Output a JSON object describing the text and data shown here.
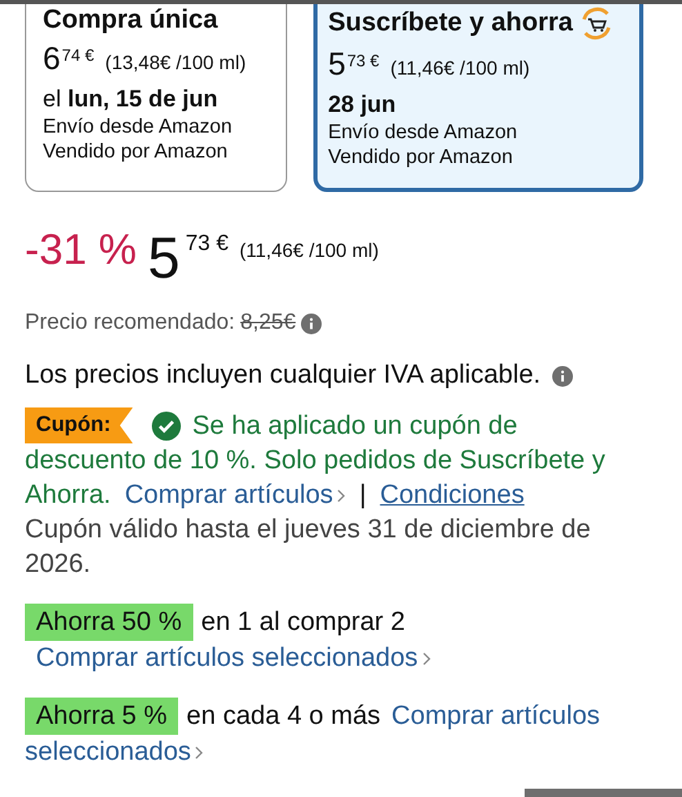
{
  "purchase_options": [
    {
      "title": "Compra única",
      "price_whole": "6",
      "price_fraction": "74 €",
      "unit_price": "(13,48€ /100 ml)",
      "delivery_prefix": "el",
      "delivery_date": "lun, 15 de jun",
      "shipping": "Envío desde Amazon",
      "seller": "Vendido por Amazon",
      "selected": false,
      "subscription_icon": false
    },
    {
      "title": "Suscríbete y ahorra",
      "price_whole": "5",
      "price_fraction": "73 €",
      "unit_price": "(11,46€ /100 ml)",
      "delivery_date": "28 jun",
      "shipping": "Envío desde Amazon",
      "seller": "Vendido por Amazon",
      "selected": true,
      "subscription_icon": true
    }
  ],
  "price": {
    "discount": "-31 %",
    "whole": "5",
    "fraction": "73 €",
    "unit_price": "(11,46€ /100 ml)"
  },
  "list_price": {
    "label": "Precio recomendado:",
    "value": "8,25€"
  },
  "tax_note": "Los precios incluyen cualquier IVA aplicable.",
  "coupon": {
    "badge": "Cupón:",
    "message_lines": [
      "Se ha aplicado un cupón de",
      "descuento de 10 %. Solo pedidos de Suscríbete y",
      "Ahorra."
    ],
    "shop_link": "Comprar artículos",
    "separator": "|",
    "terms_link": "Condiciones",
    "validity": "Cupón válido hasta el jueves 31 de diciembre de 2026."
  },
  "deals": [
    {
      "badge": "Ahorra 50 %",
      "text": "en 1 al comprar 2",
      "link_lines": [
        "Comprar artículos seleccionados"
      ],
      "link_on_new_line": true
    },
    {
      "badge": "Ahorra 5 %",
      "text": "en cada 4 o más",
      "link_lines": [
        "Comprar artículos",
        "seleccionados"
      ],
      "link_on_new_line": false
    }
  ]
}
